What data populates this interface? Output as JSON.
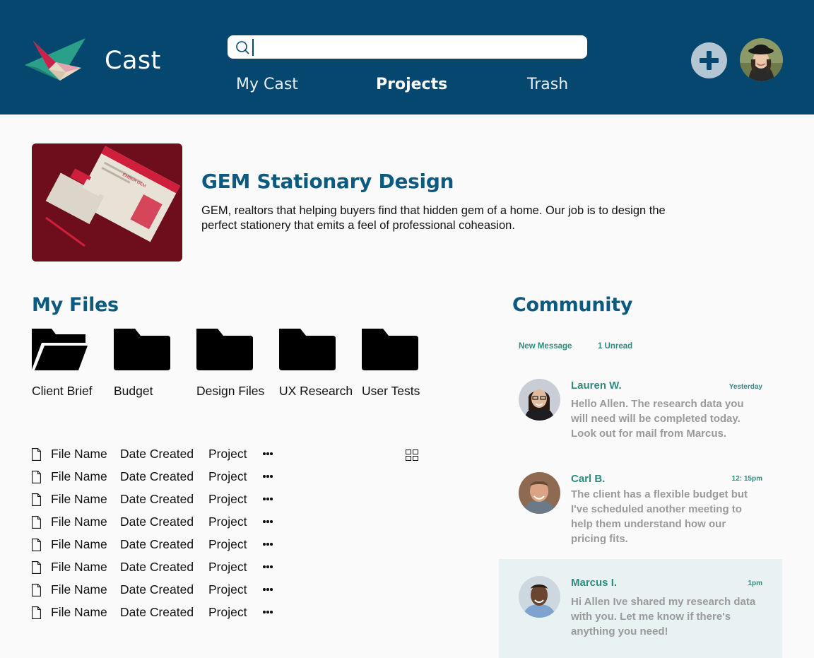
{
  "header": {
    "app_name": "Cast",
    "search": {
      "value": "",
      "placeholder": ""
    },
    "tabs": [
      {
        "label": "My Cast",
        "active": false
      },
      {
        "label": "Projects",
        "active": true
      },
      {
        "label": "Trash",
        "active": false
      }
    ],
    "add_icon": "plus-circle-icon",
    "colors": {
      "brand": "#05476f",
      "accent": "#0c5a80"
    }
  },
  "project": {
    "title": "GEM Stationary Design",
    "description": "GEM, realtors that helping buyers find that hidden gem of a home. Our job is to design the perfect stationery that emits a feel of professional coheasion.",
    "thumbnail_text": "EMBER GEM"
  },
  "files": {
    "title": "My Files",
    "folders": [
      {
        "label": "Client Brief",
        "open": true
      },
      {
        "label": "Budget",
        "open": false
      },
      {
        "label": "Design Files",
        "open": false
      },
      {
        "label": "UX Research",
        "open": false
      },
      {
        "label": "User Tests",
        "open": false
      }
    ],
    "rows": [
      {
        "name": "File Name",
        "date": "Date Created",
        "project": "Project"
      },
      {
        "name": "File Name",
        "date": "Date Created",
        "project": "Project"
      },
      {
        "name": "File Name",
        "date": "Date Created",
        "project": "Project"
      },
      {
        "name": "File Name",
        "date": "Date Created",
        "project": "Project"
      },
      {
        "name": "File Name",
        "date": "Date Created",
        "project": "Project"
      },
      {
        "name": "File Name",
        "date": "Date Created",
        "project": "Project"
      },
      {
        "name": "File Name",
        "date": "Date Created",
        "project": "Project"
      },
      {
        "name": "File Name",
        "date": "Date Created",
        "project": "Project"
      }
    ]
  },
  "community": {
    "title": "Community",
    "new_message_label": "New Message",
    "unread_label": "1 Unread",
    "messages": [
      {
        "name": "Lauren W.",
        "time": "Yesterday",
        "text": "Hello Allen. The research data you will need will be completed today. Look out for mail from Marcus.",
        "highlight": false
      },
      {
        "name": "Carl B.",
        "time": "12: 15pm",
        "text": "The client has a flexible budget but I've scheduled another meeting to help them understand how our pricing fits.",
        "highlight": false
      },
      {
        "name": "Marcus I.",
        "time": "1pm",
        "text": "Hi Allen Ive shared my research data with you. Let me know if there's anything you need!",
        "highlight": true
      }
    ]
  }
}
